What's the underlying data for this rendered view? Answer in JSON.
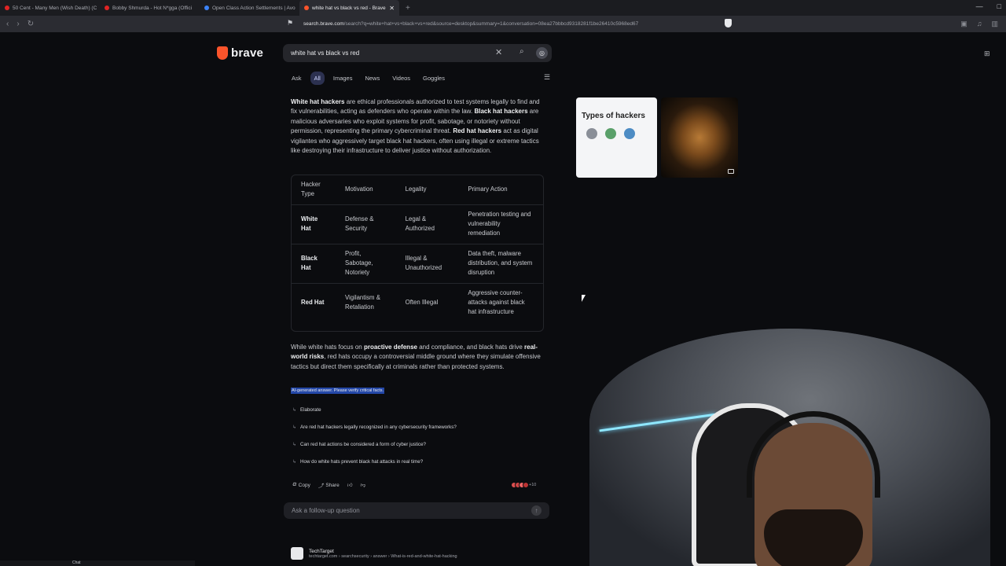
{
  "tabs": [
    {
      "title": "50 Cent - Many Men (Wish Death) (C",
      "color": "#e02424"
    },
    {
      "title": "Bobby Shmurda - Hot N*gga (Offici",
      "color": "#e02424"
    },
    {
      "title": "Open Class Action Settlements | Avo",
      "color": "#3b82f6"
    },
    {
      "title": "white hat vs black vs red - Brave",
      "color": "#fb542b",
      "active": true
    }
  ],
  "address": {
    "host": "search.brave.com",
    "path": "/search?q=white+hat+vs+black+vs+red&source=desktop&summary=1&conversation=08ea27bbbcd9318281f1be26410c5968ed67"
  },
  "brand": "brave",
  "search": {
    "query": "white hat vs black vs red"
  },
  "filters": [
    "Ask",
    "All",
    "Images",
    "News",
    "Videos",
    "Goggles"
  ],
  "answer": {
    "white_b": "White hat hackers",
    "white_t": " are ethical professionals authorized to test systems legally to find and fix vulnerabilities, acting as defenders who operate within the law.",
    "black_b": "Black hat hackers",
    "black_t": " are malicious adversaries who exploit systems for profit, sabotage, or notoriety without permission, representing the primary cybercriminal threat.",
    "red_b": "Red hat hackers",
    "red_t": " act as digital vigilantes who aggressively target black hat hackers, often using illegal or extreme tactics like destroying their infrastructure to deliver justice without authorization."
  },
  "table": {
    "headers": [
      "Hacker Type",
      "Motivation",
      "Legality",
      "Primary Action"
    ],
    "rows": [
      [
        "White Hat",
        "Defense & Security",
        "Legal & Authorized",
        "Penetration testing and vulnerability remediation"
      ],
      [
        "Black Hat",
        "Profit, Sabotage, Notoriety",
        "Illegal & Unauthorized",
        "Data theft, malware distribution, and system disruption"
      ],
      [
        "Red Hat",
        "Vigilantism & Retaliation",
        "Often Illegal",
        "Aggressive counter-attacks against black hat infrastructure"
      ]
    ]
  },
  "para2": {
    "a": "While white hats focus on ",
    "b": "proactive defense",
    "c": " and compliance, and black hats drive ",
    "d": "real-world risks",
    "e": ", red hats occupy a controversial middle ground where they simulate offensive tactics but direct them specifically at criminals rather than protected systems."
  },
  "disclaimer": "AI-generated answer. Please verify critical facts.",
  "followups": [
    "Elaborate",
    "Are red hat hackers legally recognized in any cybersecurity frameworks?",
    "Can red hat actions be considered a form of cyber justice?",
    "How do white hats prevent black hat attacks in real time?"
  ],
  "actions": {
    "copy": "Copy",
    "share": "Share",
    "sources_count": "+10"
  },
  "followup_input": {
    "placeholder": "Ask a follow-up question"
  },
  "result": {
    "site": "TechTarget",
    "crumb": "techtarget.com › searchsecurity › answer › What-is-red-and-white-hat-hacking"
  },
  "image_card": {
    "title": "Types of hackers"
  },
  "taskbar": {
    "label": "Chat"
  }
}
